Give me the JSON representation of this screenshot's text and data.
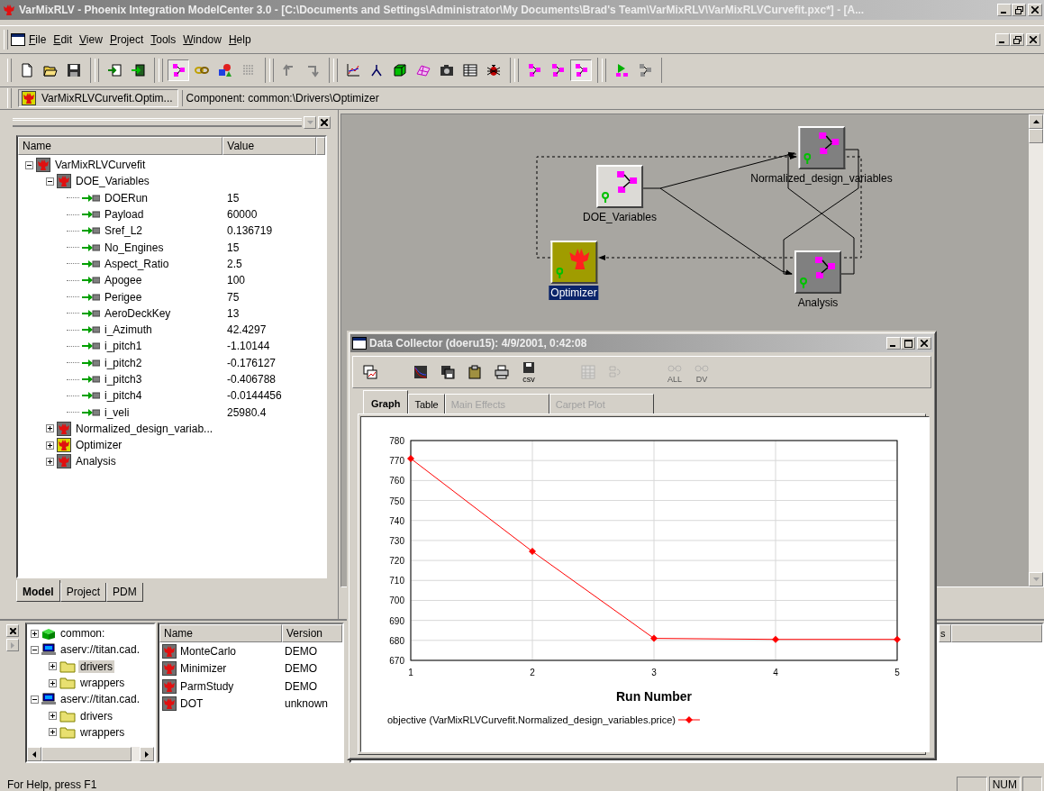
{
  "window": {
    "title": "VarMixRLV - Phoenix Integration ModelCenter 3.0 - [C:\\Documents and Settings\\Administrator\\My Documents\\Brad's Team\\VarMixRLV\\VarMixRLVCurvefit.pxc*] - [A..."
  },
  "menu": [
    "File",
    "Edit",
    "View",
    "Project",
    "Tools",
    "Window",
    "Help"
  ],
  "toolbar": [
    [
      {
        "pressed": false
      },
      {
        "pressed": false
      },
      {
        "pressed": false
      }
    ],
    [
      {
        "pressed": false
      },
      {
        "pressed": false
      }
    ],
    [
      {
        "pressed": true
      },
      {
        "pressed": false
      },
      {
        "pressed": false
      },
      {
        "pressed": false
      }
    ],
    [
      {
        "pressed": false
      },
      {
        "pressed": false
      }
    ],
    [
      {
        "pressed": false
      },
      {
        "pressed": false
      },
      {
        "pressed": false
      },
      {
        "pressed": false
      },
      {
        "pressed": false
      },
      {
        "pressed": false
      },
      {
        "pressed": false
      }
    ],
    [
      {
        "pressed": false
      },
      {
        "pressed": false
      },
      {
        "pressed": true
      }
    ],
    [
      {
        "pressed": false
      },
      {
        "pressed": false
      }
    ]
  ],
  "component_bar": {
    "tab": "VarMixRLVCurvefit.Optim...",
    "path": "Component: common:\\Drivers\\Optimizer"
  },
  "model_tree": {
    "columns": [
      "Name",
      "Value"
    ],
    "items": [
      {
        "label": "VarMixRLVCurvefit",
        "kind": "component",
        "expanded": true,
        "children": [
          {
            "label": "DOE_Variables",
            "kind": "component",
            "expanded": true,
            "children": [
              {
                "label": "DOERun",
                "kind": "variable",
                "value": "15"
              },
              {
                "label": "Payload",
                "kind": "variable",
                "value": "60000"
              },
              {
                "label": "Sref_L2",
                "kind": "variable",
                "value": "0.136719"
              },
              {
                "label": "No_Engines",
                "kind": "variable",
                "value": "15"
              },
              {
                "label": "Aspect_Ratio",
                "kind": "variable",
                "value": "2.5"
              },
              {
                "label": "Apogee",
                "kind": "variable",
                "value": "100"
              },
              {
                "label": "Perigee",
                "kind": "variable",
                "value": "75"
              },
              {
                "label": "AeroDeckKey",
                "kind": "variable",
                "value": "13"
              },
              {
                "label": "i_Azimuth",
                "kind": "variable",
                "value": "42.4297"
              },
              {
                "label": "i_pitch1",
                "kind": "variable",
                "value": "-1.10144"
              },
              {
                "label": "i_pitch2",
                "kind": "variable",
                "value": "-0.176127"
              },
              {
                "label": "i_pitch3",
                "kind": "variable",
                "value": "-0.406788"
              },
              {
                "label": "i_pitch4",
                "kind": "variable",
                "value": "-0.0144456"
              },
              {
                "label": "i_veli",
                "kind": "variable",
                "value": "25980.4"
              }
            ]
          },
          {
            "label": "Normalized_design_variab...",
            "kind": "component",
            "expanded": false
          },
          {
            "label": "Optimizer",
            "kind": "driver",
            "expanded": false
          },
          {
            "label": "Analysis",
            "kind": "component",
            "expanded": false
          }
        ]
      }
    ]
  },
  "left_tabs": [
    {
      "label": "Model",
      "selected": true
    },
    {
      "label": "Project",
      "selected": false
    },
    {
      "label": "PDM",
      "selected": false
    }
  ],
  "diagram": {
    "nodes": [
      {
        "label": "Normalized_design_variables",
        "kind": "component",
        "selected": false
      },
      {
        "label": "DOE_Variables",
        "kind": "data",
        "selected": false
      },
      {
        "label": "Optimizer",
        "kind": "driver",
        "selected": true
      },
      {
        "label": "Analysis",
        "kind": "component",
        "selected": false
      }
    ]
  },
  "library_tree": {
    "items": [
      {
        "label": "common:",
        "kind": "library",
        "expanded": false,
        "selected": false
      },
      {
        "label": "aserv://titan.cad.",
        "kind": "server",
        "expanded": true,
        "selected": false,
        "children": [
          {
            "label": "drivers",
            "kind": "folder",
            "expanded": false,
            "selected": true
          },
          {
            "label": "wrappers",
            "kind": "folder",
            "expanded": false,
            "selected": false
          }
        ]
      },
      {
        "label": "aserv://titan.cad.",
        "kind": "server",
        "expanded": true,
        "selected": false,
        "children": [
          {
            "label": "drivers",
            "kind": "folder",
            "expanded": false,
            "selected": false
          },
          {
            "label": "wrappers",
            "kind": "folder",
            "expanded": false,
            "selected": false
          }
        ]
      }
    ]
  },
  "component_list": {
    "columns": [
      "Name",
      "Version"
    ],
    "rows": [
      {
        "name": "MonteCarlo",
        "version": "DEMO"
      },
      {
        "name": "Minimizer",
        "version": "DEMO"
      },
      {
        "name": "ParmStudy",
        "version": "DEMO"
      },
      {
        "name": "DOT",
        "version": "unknown"
      }
    ]
  },
  "side_pane": {
    "column_1": "s"
  },
  "data_collector": {
    "title": "Data Collector (doeru15): 4/9/2001, 0:42:08",
    "toolbar": [
      {
        "disabled": false
      },
      {
        "disabled": false
      },
      {
        "disabled": false
      },
      {
        "disabled": false
      },
      {
        "disabled": false
      },
      {
        "disabled": false,
        "label": "csv"
      },
      {
        "disabled": true
      },
      {
        "disabled": true
      },
      {
        "disabled": true,
        "label": "ALL"
      },
      {
        "disabled": true,
        "label": "DV"
      }
    ],
    "tabs": [
      {
        "label": "Graph",
        "selected": true,
        "disabled": false
      },
      {
        "label": "Table",
        "selected": false,
        "disabled": false
      },
      {
        "label": "Main Effects",
        "selected": false,
        "disabled": true
      },
      {
        "label": "Carpet Plot",
        "selected": false,
        "disabled": true
      }
    ],
    "chart_data": {
      "type": "line",
      "xlabel": "Run Number",
      "x": [
        1,
        2,
        3,
        4,
        5
      ],
      "series": [
        {
          "name": "objective (VarMixRLVCurvefit.Normalized_design_variables.price)",
          "color": "#ff0000",
          "values": [
            771,
            724.5,
            681,
            680.5,
            680.5
          ]
        }
      ],
      "grid": true,
      "marker": "diamond",
      "xlim": [
        1,
        5
      ],
      "ylim": [
        670,
        780
      ],
      "xticks": [
        1,
        2,
        3,
        4,
        5
      ],
      "yticks": [
        670,
        680,
        690,
        700,
        710,
        720,
        730,
        740,
        750,
        760,
        770,
        780
      ]
    }
  },
  "status_bar": {
    "message": "For Help, press F1",
    "indicator": "NUM"
  }
}
